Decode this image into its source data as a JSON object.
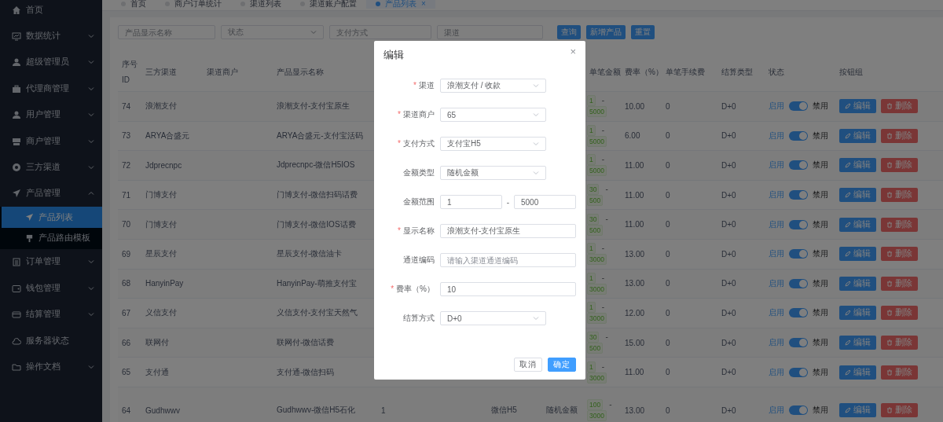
{
  "sidebar": {
    "items": [
      {
        "label": "首页",
        "kind": "link",
        "selected": false
      },
      {
        "label": "数据统计",
        "kind": "group",
        "expanded": false,
        "selected": false
      },
      {
        "label": "超级管理员",
        "kind": "group",
        "expanded": false,
        "selected": false
      },
      {
        "label": "代理商管理",
        "kind": "group",
        "expanded": false,
        "selected": false
      },
      {
        "label": "用户管理",
        "kind": "group",
        "expanded": false,
        "selected": false
      },
      {
        "label": "商户管理",
        "kind": "group",
        "expanded": false,
        "selected": false
      },
      {
        "label": "三方渠道",
        "kind": "group",
        "expanded": false,
        "selected": false
      },
      {
        "label": "产品管理",
        "kind": "group",
        "expanded": true,
        "selected": false,
        "children": [
          {
            "label": "产品列表",
            "selected": true
          },
          {
            "label": "产品路由模板",
            "selected": false
          }
        ]
      },
      {
        "label": "订单管理",
        "kind": "group",
        "expanded": false,
        "selected": false
      },
      {
        "label": "钱包管理",
        "kind": "group",
        "expanded": false,
        "selected": false
      },
      {
        "label": "结算管理",
        "kind": "group",
        "expanded": false,
        "selected": false
      },
      {
        "label": "服务器状态",
        "kind": "link",
        "selected": false
      },
      {
        "label": "操作文档",
        "kind": "group",
        "expanded": false,
        "selected": false
      }
    ]
  },
  "tabs": [
    {
      "label": "首页",
      "selected": false
    },
    {
      "label": "商户订单统计",
      "selected": false
    },
    {
      "label": "渠道列表",
      "selected": false
    },
    {
      "label": "渠道账户配置",
      "selected": false
    },
    {
      "label": "产品列表",
      "selected": true,
      "close": "×"
    }
  ],
  "filters": [
    {
      "kind": "input",
      "placeholder": "产品显示名称"
    },
    {
      "kind": "select",
      "placeholder": "状态"
    },
    {
      "kind": "input",
      "placeholder": "支付方式"
    },
    {
      "kind": "input",
      "placeholder": "渠道"
    }
  ],
  "filter_buttons": [
    "查询",
    "新增产品",
    "重置"
  ],
  "table": {
    "columns": [
      "序号 ID",
      "三方渠道",
      "渠道商户",
      "产品显示名称",
      "单笔金额",
      "费率（%）",
      "单笔手续费",
      "结算类型",
      "状态",
      "按钮组"
    ],
    "rows": [
      {
        "id": "74",
        "channel": "浪潮支付",
        "product": "浪潮支付-支付宝原生",
        "amount_min": "1",
        "sep": "-",
        "amount_max": "5000",
        "rate": "10.00",
        "fee": "0",
        "settle": "D+0",
        "enabled": true,
        "on_label": "启用",
        "off_label": "禁用",
        "edit": "编辑",
        "delete": "删除"
      },
      {
        "id": "73",
        "channel": "ARYA合盛元",
        "product": "ARYA合盛元-支付宝活码",
        "amount_min": "1",
        "sep": "-",
        "amount_max": "5000",
        "rate": "6.00",
        "fee": "0",
        "settle": "D+0",
        "enabled": true,
        "on_label": "启用",
        "off_label": "禁用",
        "edit": "编辑",
        "delete": "删除"
      },
      {
        "id": "72",
        "channel": "Jdprecnpc",
        "product": "Jdprecnpc-微信H5IOS",
        "amount_min": "1",
        "sep": "-",
        "amount_max": "5000",
        "rate": "11.00",
        "fee": "0",
        "settle": "D+0",
        "enabled": true,
        "on_label": "启用",
        "off_label": "禁用",
        "edit": "编辑",
        "delete": "删除"
      },
      {
        "id": "71",
        "channel": "门博支付",
        "product": "门博支付-微信扫码话费",
        "amount_min": "30",
        "sep": "-",
        "amount_max": "500",
        "rate": "11.00",
        "fee": "0",
        "settle": "D+0",
        "enabled": true,
        "on_label": "启用",
        "off_label": "禁用",
        "edit": "编辑",
        "delete": "删除"
      },
      {
        "id": "70",
        "channel": "门博支付",
        "product": "门博支付-微信IOS话费",
        "amount_min": "30",
        "sep": "-",
        "amount_max": "500",
        "rate": "11.00",
        "fee": "0",
        "settle": "D+0",
        "enabled": true,
        "on_label": "启用",
        "off_label": "禁用",
        "edit": "编辑",
        "delete": "删除"
      },
      {
        "id": "69",
        "channel": "星辰支付",
        "product": "星辰支付-微信油卡",
        "amount_min": "1",
        "sep": "-",
        "amount_max": "3000",
        "rate": "13.00",
        "fee": "0",
        "settle": "D+0",
        "enabled": true,
        "on_label": "启用",
        "off_label": "禁用",
        "edit": "编辑",
        "delete": "删除"
      },
      {
        "id": "68",
        "channel": "HanyinPay",
        "product": "HanyinPay-萌推支付宝",
        "amount_min": "1",
        "sep": "-",
        "amount_max": "3000",
        "rate": "13.00",
        "fee": "0",
        "settle": "D+0",
        "enabled": true,
        "on_label": "启用",
        "off_label": "禁用",
        "edit": "编辑",
        "delete": "删除"
      },
      {
        "id": "67",
        "channel": "义信支付",
        "product": "义信支付-支付宝天然气",
        "amount_min": "1",
        "sep": "-",
        "amount_max": "3000",
        "rate": "12.00",
        "fee": "0",
        "settle": "D+0",
        "enabled": true,
        "on_label": "启用",
        "off_label": "禁用",
        "edit": "编辑",
        "delete": "删除"
      },
      {
        "id": "66",
        "channel": "联网付",
        "product": "联网付-微信话费",
        "amount_min": "30",
        "sep": "-",
        "amount_max": "500",
        "rate": "15.00",
        "fee": "0",
        "settle": "D+0",
        "enabled": true,
        "on_label": "启用",
        "off_label": "禁用",
        "edit": "编辑",
        "delete": "删除"
      },
      {
        "id": "65",
        "channel": "支付通",
        "product": "支付通-微信扫码",
        "amount_min": "1",
        "sep": "-",
        "amount_max": "3000",
        "rate": "11.00",
        "fee": "0",
        "settle": "D+0",
        "enabled": true,
        "on_label": "启用",
        "off_label": "禁用",
        "edit": "编辑",
        "delete": "删除"
      },
      {
        "id": "64",
        "channel": "Gudhwwv",
        "product": "Gudhwwv-微信H5石化",
        "column_5": "1",
        "column_6": "微信H5",
        "column_7": "随机金额",
        "amount_min": "100",
        "sep": "-",
        "amount_max": "3000",
        "rate": "13.00",
        "fee": "0",
        "settle": "D+0",
        "enabled": true,
        "on_label": "启用",
        "off_label": "禁用",
        "edit": "编辑",
        "delete": "删除"
      }
    ]
  },
  "dialog": {
    "title": "编辑",
    "close": "×",
    "fields": [
      {
        "kind": "select",
        "label": "渠道",
        "required_mark": "*",
        "value": "浪潮支付 / 收款"
      },
      {
        "kind": "select",
        "label": "渠道商户",
        "required_mark": "*",
        "value": "65"
      },
      {
        "kind": "select",
        "label": "支付方式",
        "required_mark": "*",
        "value": "支付宝H5"
      },
      {
        "kind": "select",
        "label": "金额类型",
        "value": "随机金额"
      },
      {
        "kind": "range",
        "label": "金额范围",
        "min": "1",
        "sep": "-",
        "max": "5000"
      },
      {
        "kind": "input",
        "label": "显示名称",
        "required_mark": "*",
        "value": "浪潮支付-支付宝原生"
      },
      {
        "kind": "input",
        "label": "通道编码",
        "placeholder": "请输入渠道通道编码"
      },
      {
        "kind": "input",
        "label": "费率（%）",
        "required_mark": "*",
        "value": "10"
      },
      {
        "kind": "select",
        "label": "结算方式",
        "value": "D+0"
      }
    ],
    "buttons": [
      {
        "label": "取消",
        "kind": "default"
      },
      {
        "label": "确定",
        "kind": "primary"
      }
    ]
  }
}
